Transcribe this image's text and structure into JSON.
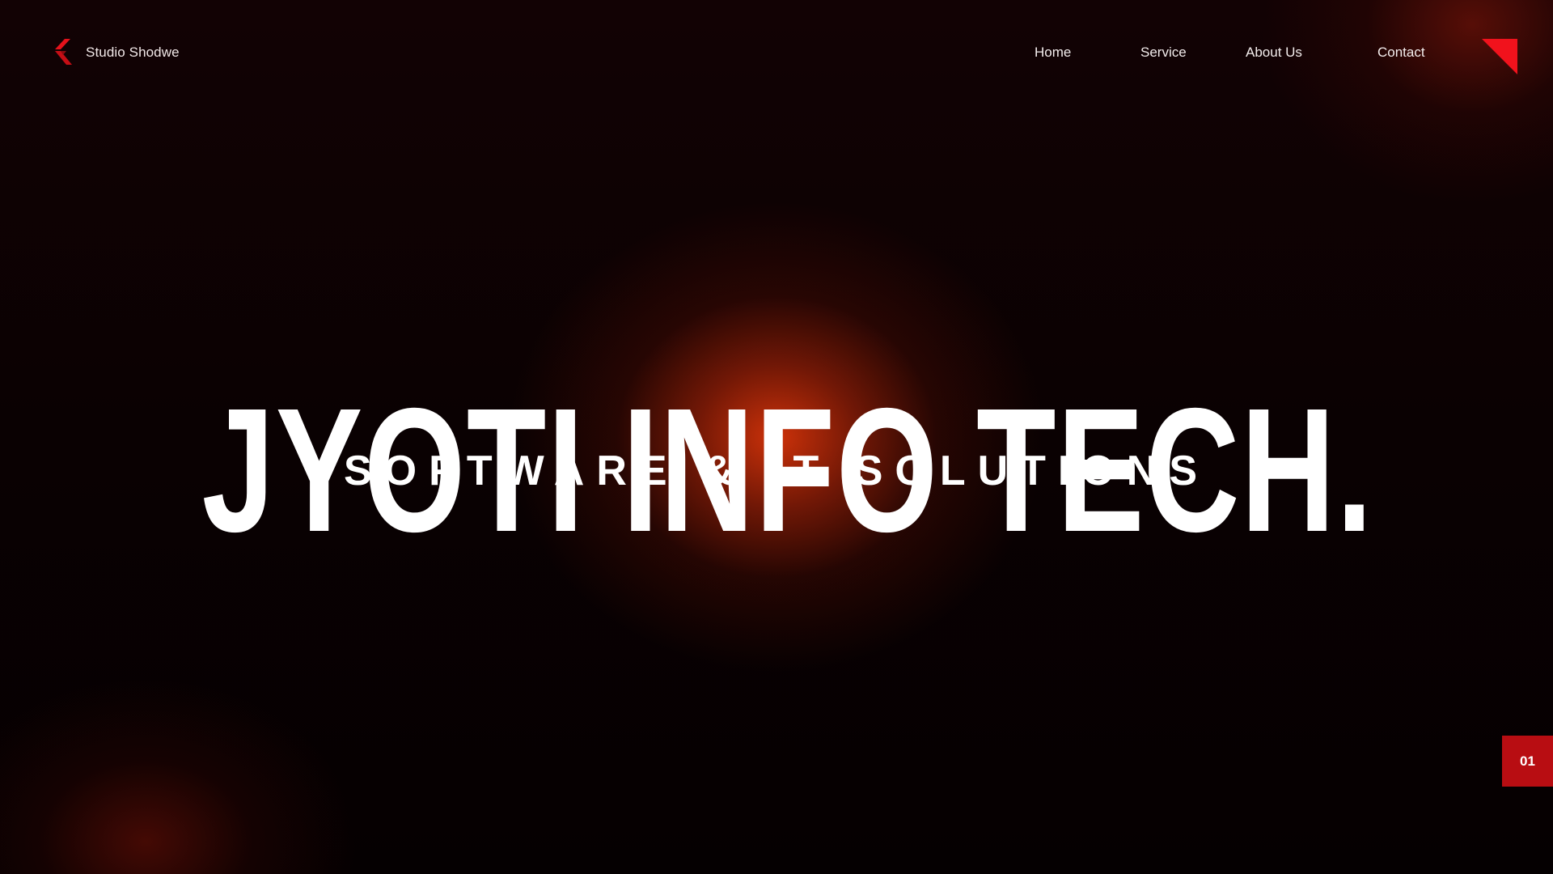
{
  "header": {
    "brand_name": "Studio Shodwe",
    "brand_logo_icon": "chevron-logo-icon",
    "corner_icon": "corner-triangle-icon"
  },
  "nav": {
    "items": [
      {
        "label": "Home"
      },
      {
        "label": "Service"
      },
      {
        "label": "About Us"
      },
      {
        "label": "Contact"
      }
    ]
  },
  "hero": {
    "title": "JYOTI INFO TECH.",
    "subtitle": "SOFTWARE & IT SOLUTIONS"
  },
  "slide": {
    "number": "01"
  },
  "colors": {
    "accent": "#e5121b",
    "badge": "#b80d12",
    "glow": "#d7340a",
    "background": "#070001",
    "text": "#ffffff"
  }
}
